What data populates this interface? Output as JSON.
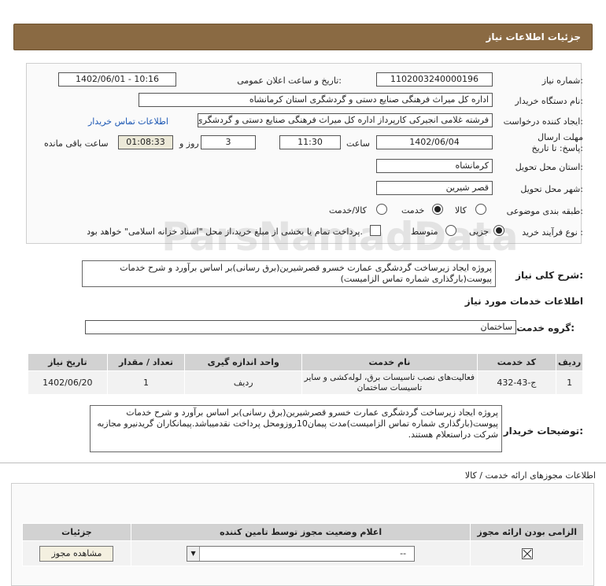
{
  "header": {
    "title": "جزئیات اطلاعات نیاز"
  },
  "form": {
    "need_number_label": "شماره نیاز:",
    "need_number": "1102003240000196",
    "announce_label": "تاریخ و ساعت اعلان عمومی:",
    "announce_value": "1402/06/01 - 10:16",
    "buyer_org_label": "نام دستگاه خریدار:",
    "buyer_org": "اداره کل میراث فرهنگی  صنایع دستی و گردشگری استان کرمانشاه",
    "requester_label": "ایجاد کننده درخواست:",
    "requester": "فرشته غلامی انجیرکی کارپرداز اداره کل میراث فرهنگی  صنایع دستی و گردشگری استان کرمانشاه",
    "contact_link": "اطلاعات تماس خریدار",
    "deadline_label": "مهلت ارسال پاسخ: تا تاریخ:",
    "deadline_date": "1402/06/04",
    "time_label": "ساعت",
    "deadline_time": "11:30",
    "days_value": "3",
    "days_label": "روز و",
    "remaining_time": "01:08:33",
    "remaining_label": "ساعت باقی مانده",
    "province_label": "استان محل تحویل:",
    "province": "کرمانشاه",
    "city_label": "شهر محل تحویل:",
    "city": "قصر شیرین",
    "category_label": "طبقه بندی موضوعی:",
    "category_options": [
      "کالا",
      "خدمت",
      "کالا/خدمت"
    ],
    "category_selected": 1,
    "process_label": "نوع فرآیند خرید :",
    "process_options": [
      "جزیی",
      "متوسط"
    ],
    "process_selected": 0,
    "treasury_note": "پرداخت تمام یا بخشی از مبلغ خرید،از محل \"اسناد خزانه اسلامی\" خواهد بود."
  },
  "summary": {
    "label": "شرح کلی نیاز:",
    "text": "پروژه ایجاد زیرساخت گردشگری عمارت خسرو قصرشیرین(برق رسانی)بر اساس برآورد و شرح خدمات پیوست(بارگذاری شماره تماس الزامیست)"
  },
  "services": {
    "title": "اطلاعات خدمات مورد نیاز",
    "group_label": "گروه خدمت:",
    "group_value": "ساختمان",
    "columns": [
      "ردیف",
      "کد خدمت",
      "نام خدمت",
      "واحد اندازه گیری",
      "تعداد / مقدار",
      "تاریخ نیاز"
    ],
    "rows": [
      {
        "index": "1",
        "code": "ج-43-432",
        "name": "فعالیت‌های نصب تاسیسات برق، لوله‌کشی و سایر تاسیسات ساختمان",
        "unit": "ردیف",
        "qty": "1",
        "date": "1402/06/20"
      }
    ]
  },
  "buyer_notes": {
    "label": "توضیحات خریدار:",
    "text": "پروژه ایجاد زیرساخت گردشگری عمارت خسرو قصرشیرین(برق رسانی)بر اساس برآورد و شرح خدمات پیوست(بارگذاری شماره تماس الزامیست)مدت پیمان10روزومحل پرداخت نقدمیباشد.پیمانکاران گریدنیرو مجازبه شرکت دراستعلام هستند."
  },
  "licenses": {
    "title": "اطلاعات مجوزهای ارائه خدمت / کالا",
    "columns": [
      "الزامی بودن ارائه مجوز",
      "اعلام وضعیت مجوز توسط تامین کننده",
      "جزئیات"
    ],
    "row": {
      "status_value": "--",
      "details_button": "مشاهده مجوز"
    }
  },
  "watermark": {
    "line1": "ParsNamadData"
  }
}
